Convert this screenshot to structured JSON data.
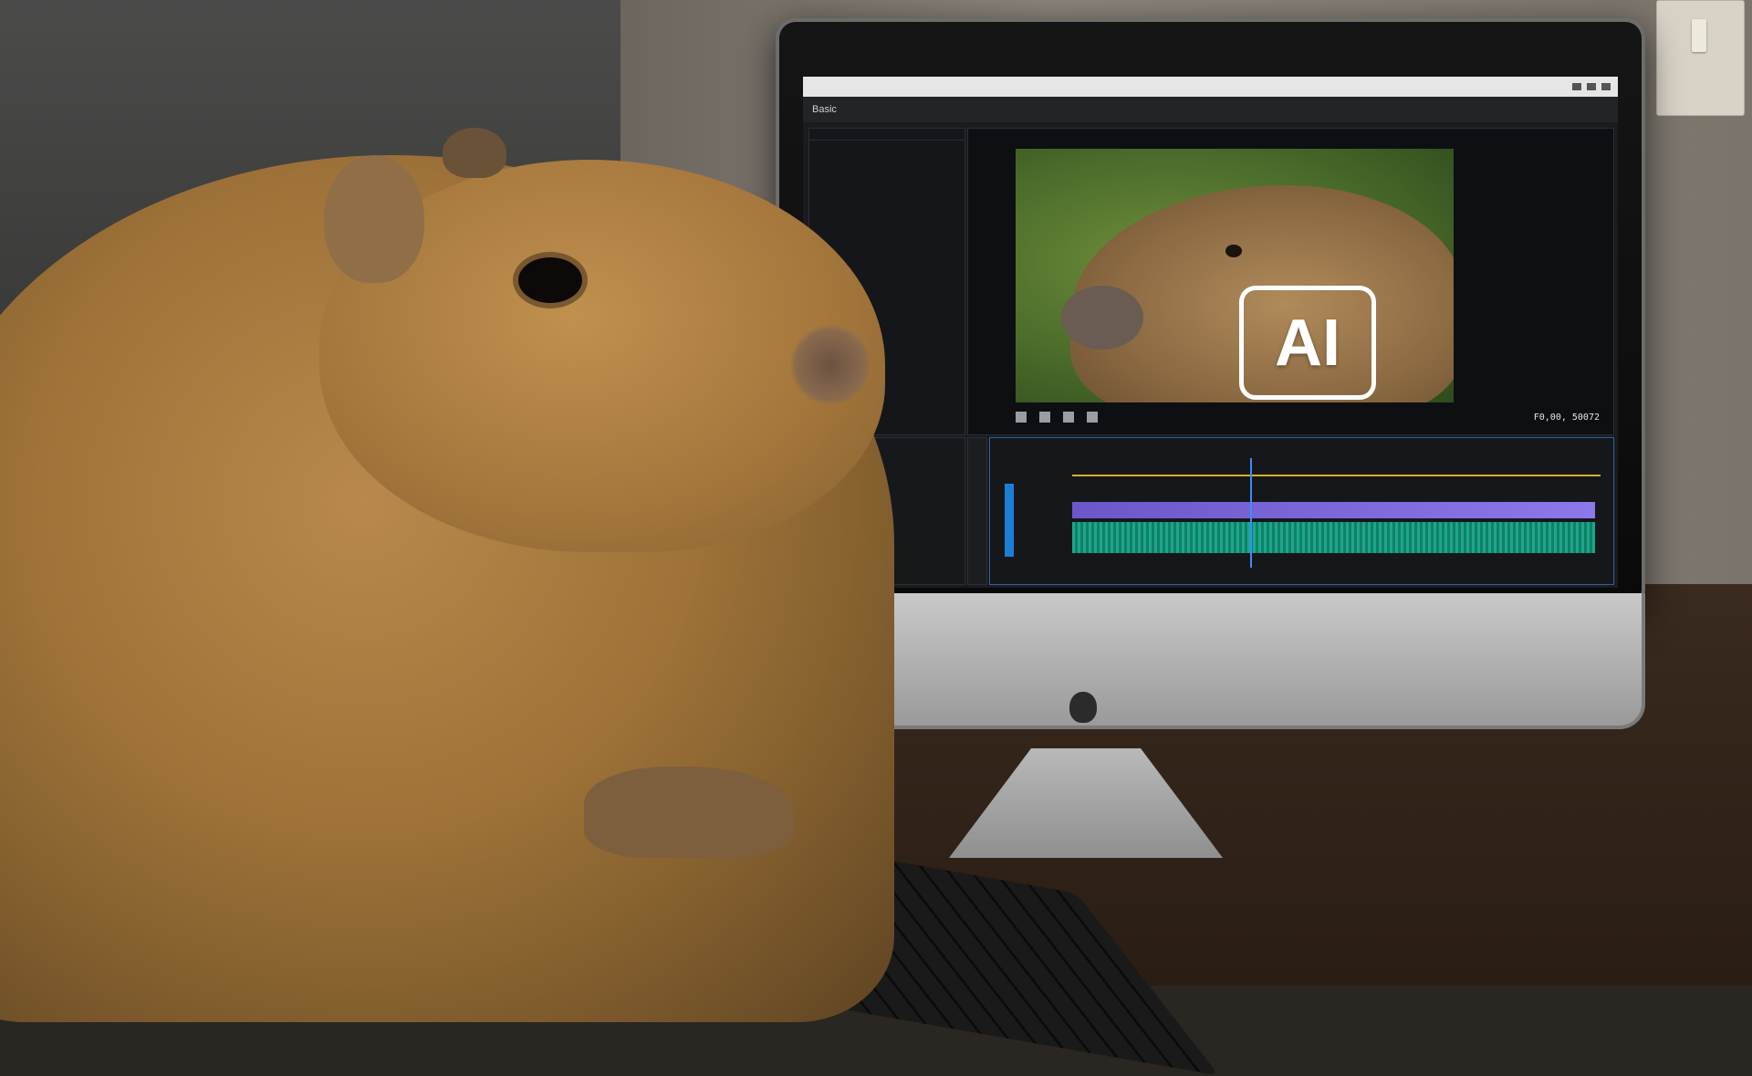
{
  "screen": {
    "menubar": {
      "app_name": "Basic",
      "workspaces": [
        "",
        "",
        "",
        "",
        "",
        "",
        ""
      ],
      "active_index": 3
    },
    "left_panel": {
      "tabs": [
        "",
        "",
        ""
      ],
      "hint": ""
    },
    "program_monitor": {
      "label": "",
      "overlay_text": "AI",
      "timecode": "F0,00, 50072"
    },
    "timeline": {
      "title": "",
      "ruler_labels": [
        "",
        "",
        "",
        "",
        ""
      ]
    }
  },
  "colors": {
    "timeline_border": "#2f5fa8",
    "video_clip": "#8c78ea",
    "audio_clip": "#1aa88a",
    "work_area_bar": "#d3b322",
    "active_workspace": "#4aa0ff"
  },
  "icons": [
    "apple-logo-icon",
    "play-icon",
    "step-back-icon",
    "step-forward-icon",
    "camera-icon"
  ]
}
